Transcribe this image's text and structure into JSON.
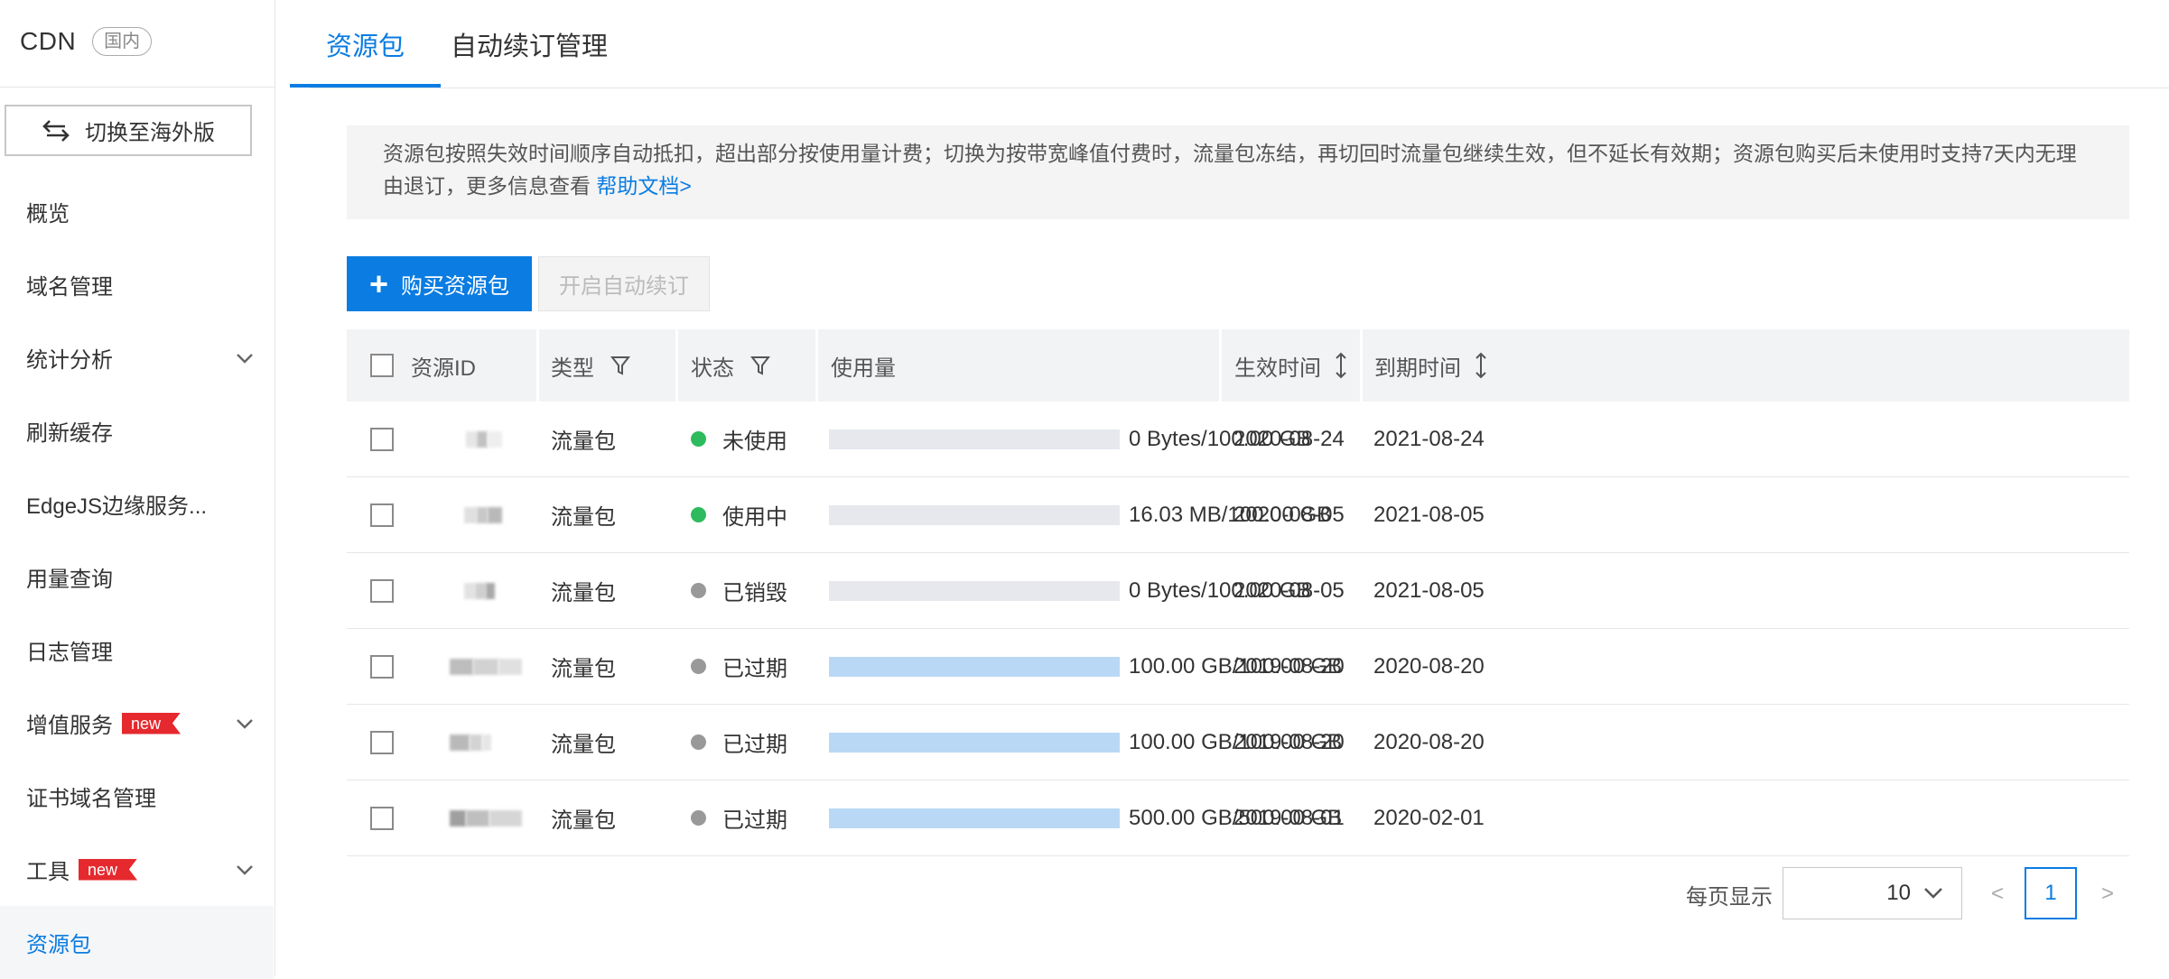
{
  "sidebar": {
    "brand": "CDN",
    "region_badge": "国内",
    "switch_button": "切换至海外版",
    "items": [
      {
        "label": "概览",
        "has_arrow": false,
        "is_new": false,
        "active": false
      },
      {
        "label": "域名管理",
        "has_arrow": false,
        "is_new": false,
        "active": false
      },
      {
        "label": "统计分析",
        "has_arrow": true,
        "is_new": false,
        "active": false
      },
      {
        "label": "刷新缓存",
        "has_arrow": false,
        "is_new": false,
        "active": false
      },
      {
        "label": "EdgeJS边缘服务...",
        "has_arrow": false,
        "is_new": false,
        "active": false
      },
      {
        "label": "用量查询",
        "has_arrow": false,
        "is_new": false,
        "active": false
      },
      {
        "label": "日志管理",
        "has_arrow": false,
        "is_new": false,
        "active": false
      },
      {
        "label": "增值服务",
        "has_arrow": true,
        "is_new": true,
        "active": false
      },
      {
        "label": "证书域名管理",
        "has_arrow": false,
        "is_new": false,
        "active": false
      },
      {
        "label": "工具",
        "has_arrow": true,
        "is_new": true,
        "active": false
      },
      {
        "label": "资源包",
        "has_arrow": false,
        "is_new": false,
        "active": true
      }
    ],
    "new_tag": "new"
  },
  "tabs": [
    {
      "label": "资源包",
      "active": true
    },
    {
      "label": "自动续订管理",
      "active": false
    }
  ],
  "notice": {
    "text": "资源包按照失效时间顺序自动抵扣，超出部分按使用量计费；切换为按带宽峰值付费时，流量包冻结，再切回时流量包继续生效，但不延长有效期；资源包购买后未使用时支持7天内无理由退订，更多信息查看 ",
    "link": "帮助文档>"
  },
  "actions": {
    "buy": "购买资源包",
    "auto_renew": "开启自动续订"
  },
  "table": {
    "headers": {
      "id": "资源ID",
      "type": "类型",
      "status": "状态",
      "usage": "使用量",
      "start": "生效时间",
      "end": "到期时间"
    },
    "rows": [
      {
        "type": "流量包",
        "status": "未使用",
        "status_color": "#2dbb5d",
        "usage_fraction": 0.0,
        "usage_text": "0 Bytes/100.00 GB",
        "start": "2020-08-24",
        "end": "2021-08-24"
      },
      {
        "type": "流量包",
        "status": "使用中",
        "status_color": "#2dbb5d",
        "usage_fraction": 0.0002,
        "usage_text": "16.03 MB/100.00 GB",
        "start": "2020-08-05",
        "end": "2021-08-05"
      },
      {
        "type": "流量包",
        "status": "已销毁",
        "status_color": "#999999",
        "usage_fraction": 0.0,
        "usage_text": "0 Bytes/100.00 GB",
        "start": "2020-08-05",
        "end": "2021-08-05"
      },
      {
        "type": "流量包",
        "status": "已过期",
        "status_color": "#999999",
        "usage_fraction": 1.0,
        "usage_text": "100.00 GB/100.00 GB",
        "start": "2019-08-20",
        "end": "2020-08-20"
      },
      {
        "type": "流量包",
        "status": "已过期",
        "status_color": "#999999",
        "usage_fraction": 1.0,
        "usage_text": "100.00 GB/100.00 GB",
        "start": "2019-08-20",
        "end": "2020-08-20"
      },
      {
        "type": "流量包",
        "status": "已过期",
        "status_color": "#999999",
        "usage_fraction": 1.0,
        "usage_text": "500.00 GB/500.00 GB",
        "start": "2019-08-01",
        "end": "2020-02-01"
      }
    ]
  },
  "pagination": {
    "per_page_label": "每页显示",
    "per_page_value": "10",
    "current_page": "1",
    "prev": "<",
    "next": ">"
  }
}
